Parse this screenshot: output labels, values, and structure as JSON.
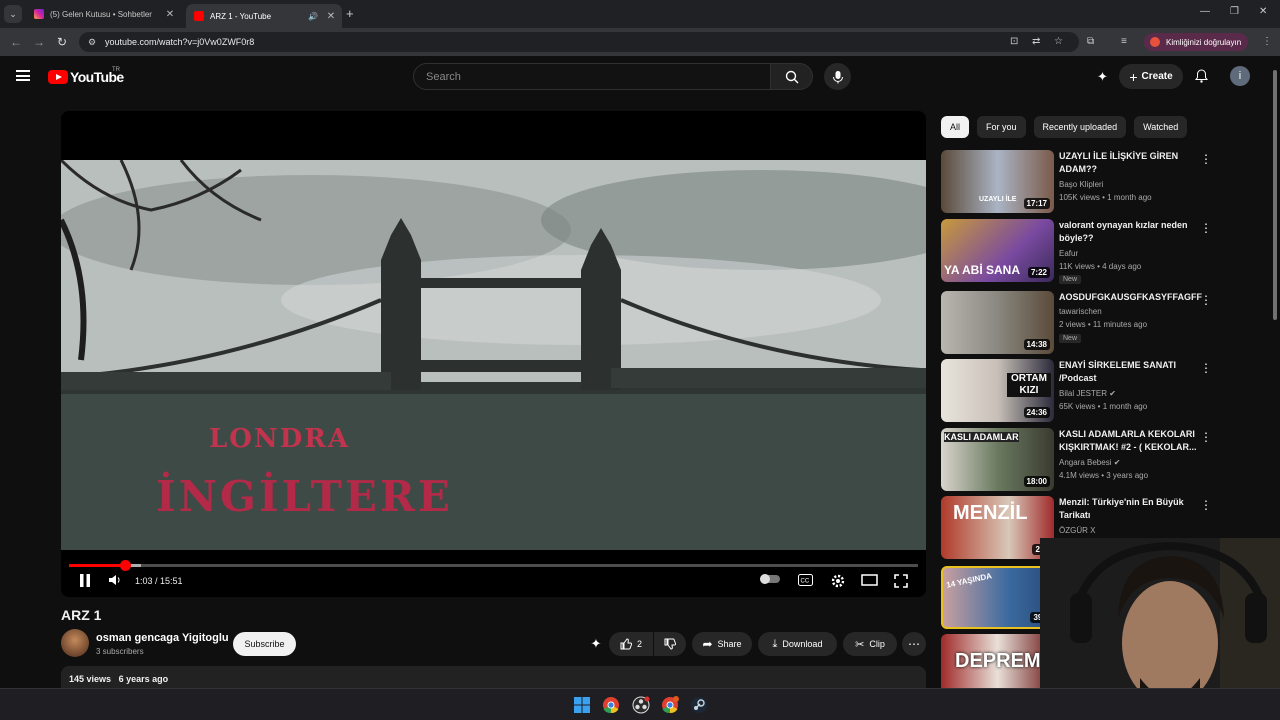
{
  "browser": {
    "tabs": [
      {
        "title": "(5) Gelen Kutusu • Sohbetler",
        "favicon_color": "#d6249f"
      },
      {
        "title": "ARZ 1 - YouTube",
        "favicon_color": "#ff0000"
      }
    ],
    "url": "youtube.com/watch?v=j0Vw0ZWF0r8",
    "profile_label": "Kimliğinizi doğrulayın"
  },
  "youtube": {
    "logo_text": "YouTube",
    "country_code": "TR",
    "search_placeholder": "Search",
    "create_label": "Create",
    "avatar_letter": "i"
  },
  "player": {
    "overlay_line1": "LONDRA",
    "overlay_line2": "İNGİLTERE",
    "current_time": "1:03 / 15:51",
    "progress": 0.066
  },
  "video": {
    "title": "ARZ 1",
    "channel_name": "osman gencaga Yigitoglu",
    "subscribers": "3 subscribers",
    "subscribe_label": "Subscribe",
    "likes": "2",
    "share_label": "Share",
    "download_label": "Download",
    "clip_label": "Clip",
    "views": "145 views",
    "uploaded": "6 years ago"
  },
  "chips": [
    "All",
    "For you",
    "Recently uploaded",
    "Watched"
  ],
  "recommendations": [
    {
      "title": "UZAYLI İLE İLİŞKİYE GİREN ADAM??",
      "channel": "Başo Klipleri",
      "meta": "105K views • 1 month ago",
      "duration": "17:17",
      "thumb_color": "#6a7a8a",
      "new": ""
    },
    {
      "title": "valorant oynayan kızlar neden böyle??",
      "channel": "Eafur",
      "meta": "11K views • 4 days ago",
      "duration": "7:22",
      "thumb_color": "#7a4aa0",
      "new": "New"
    },
    {
      "title": "AOSDUFGKAUSGFKASYFFAGFF",
      "channel": "tawarischen",
      "meta": "2 views • 11 minutes ago",
      "duration": "14:38",
      "thumb_color": "#9a9890",
      "new": "New"
    },
    {
      "title": "ENAYİ SİRKELEME SANATI /Podcast",
      "channel": "Bilal JESTER",
      "meta": "65K views • 1 month ago",
      "duration": "24:36",
      "thumb_color": "#d8d0c8",
      "new": ""
    },
    {
      "title": "KASLI ADAMLARLA KEKOLARI KIŞKIRTMAK! #2 - ( KEKOLAR...",
      "channel": "Angara Bebesi",
      "meta": "4.1M views • 3 years ago",
      "duration": "18:00",
      "thumb_color": "#5a6a50",
      "new": ""
    },
    {
      "title": "Menzil: Türkiye'nin En Büyük Tarikatı",
      "channel": "ÖZGÜR X",
      "meta": "",
      "duration": "29:",
      "thumb_color": "#b03a2a",
      "new": ""
    },
    {
      "title": "",
      "channel": "",
      "meta": "",
      "duration": "39:",
      "thumb_color": "#3a6aa0",
      "new": ""
    },
    {
      "title": "",
      "channel": "",
      "meta": "",
      "duration": "",
      "thumb_color": "#a02a2a",
      "new": ""
    }
  ],
  "rec_thumb_text": {
    "t1": "UZAYLI İLE",
    "t2": "YA ABİ SANA",
    "t4": "ORTAM KIZI",
    "t5": "KASLI ADAMLAR",
    "t6": "MENZİL",
    "t7": "14 YAŞINDA",
    "t8": "DEPREM"
  }
}
